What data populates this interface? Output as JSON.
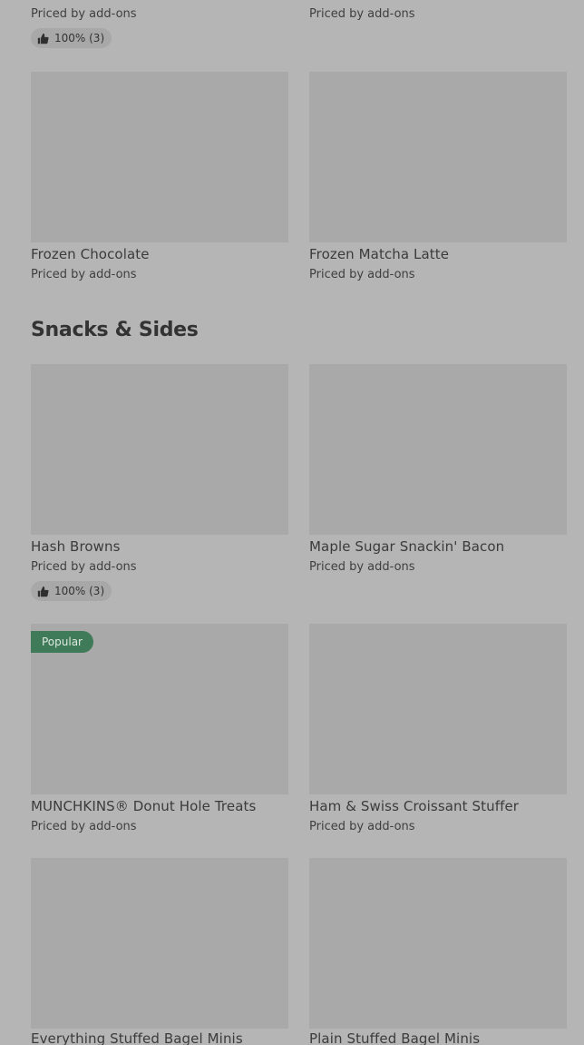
{
  "top_partial": {
    "left": {
      "price": "Priced by add-ons",
      "rating": "100% (3)"
    },
    "right": {
      "price": "Priced by add-ons"
    }
  },
  "frozen_row": [
    {
      "name": "Frozen Chocolate",
      "price": "Priced by add-ons"
    },
    {
      "name": "Frozen Matcha Latte",
      "price": "Priced by add-ons"
    }
  ],
  "snacks_section": {
    "title": "Snacks & Sides",
    "items": [
      {
        "name": "Hash Browns",
        "price": "Priced by add-ons",
        "rating": "100% (3)"
      },
      {
        "name": "Maple Sugar Snackin' Bacon",
        "price": "Priced by add-ons"
      },
      {
        "name": "MUNCHKINS® Donut Hole Treats",
        "price": "Priced by add-ons",
        "badge": "Popular"
      },
      {
        "name": "Ham & Swiss Croissant Stuffer",
        "price": "Priced by add-ons"
      },
      {
        "name": "Everything Stuffed Bagel Minis"
      },
      {
        "name": "Plain Stuffed Bagel Minis"
      }
    ]
  },
  "icons": {
    "rating": "thumbs-up-icon"
  },
  "colors": {
    "background": "#b5b5b5",
    "image_placeholder": "#a9a9a9",
    "popular_badge": "#3f7b58",
    "rating_pill": "#a8a8a8"
  }
}
